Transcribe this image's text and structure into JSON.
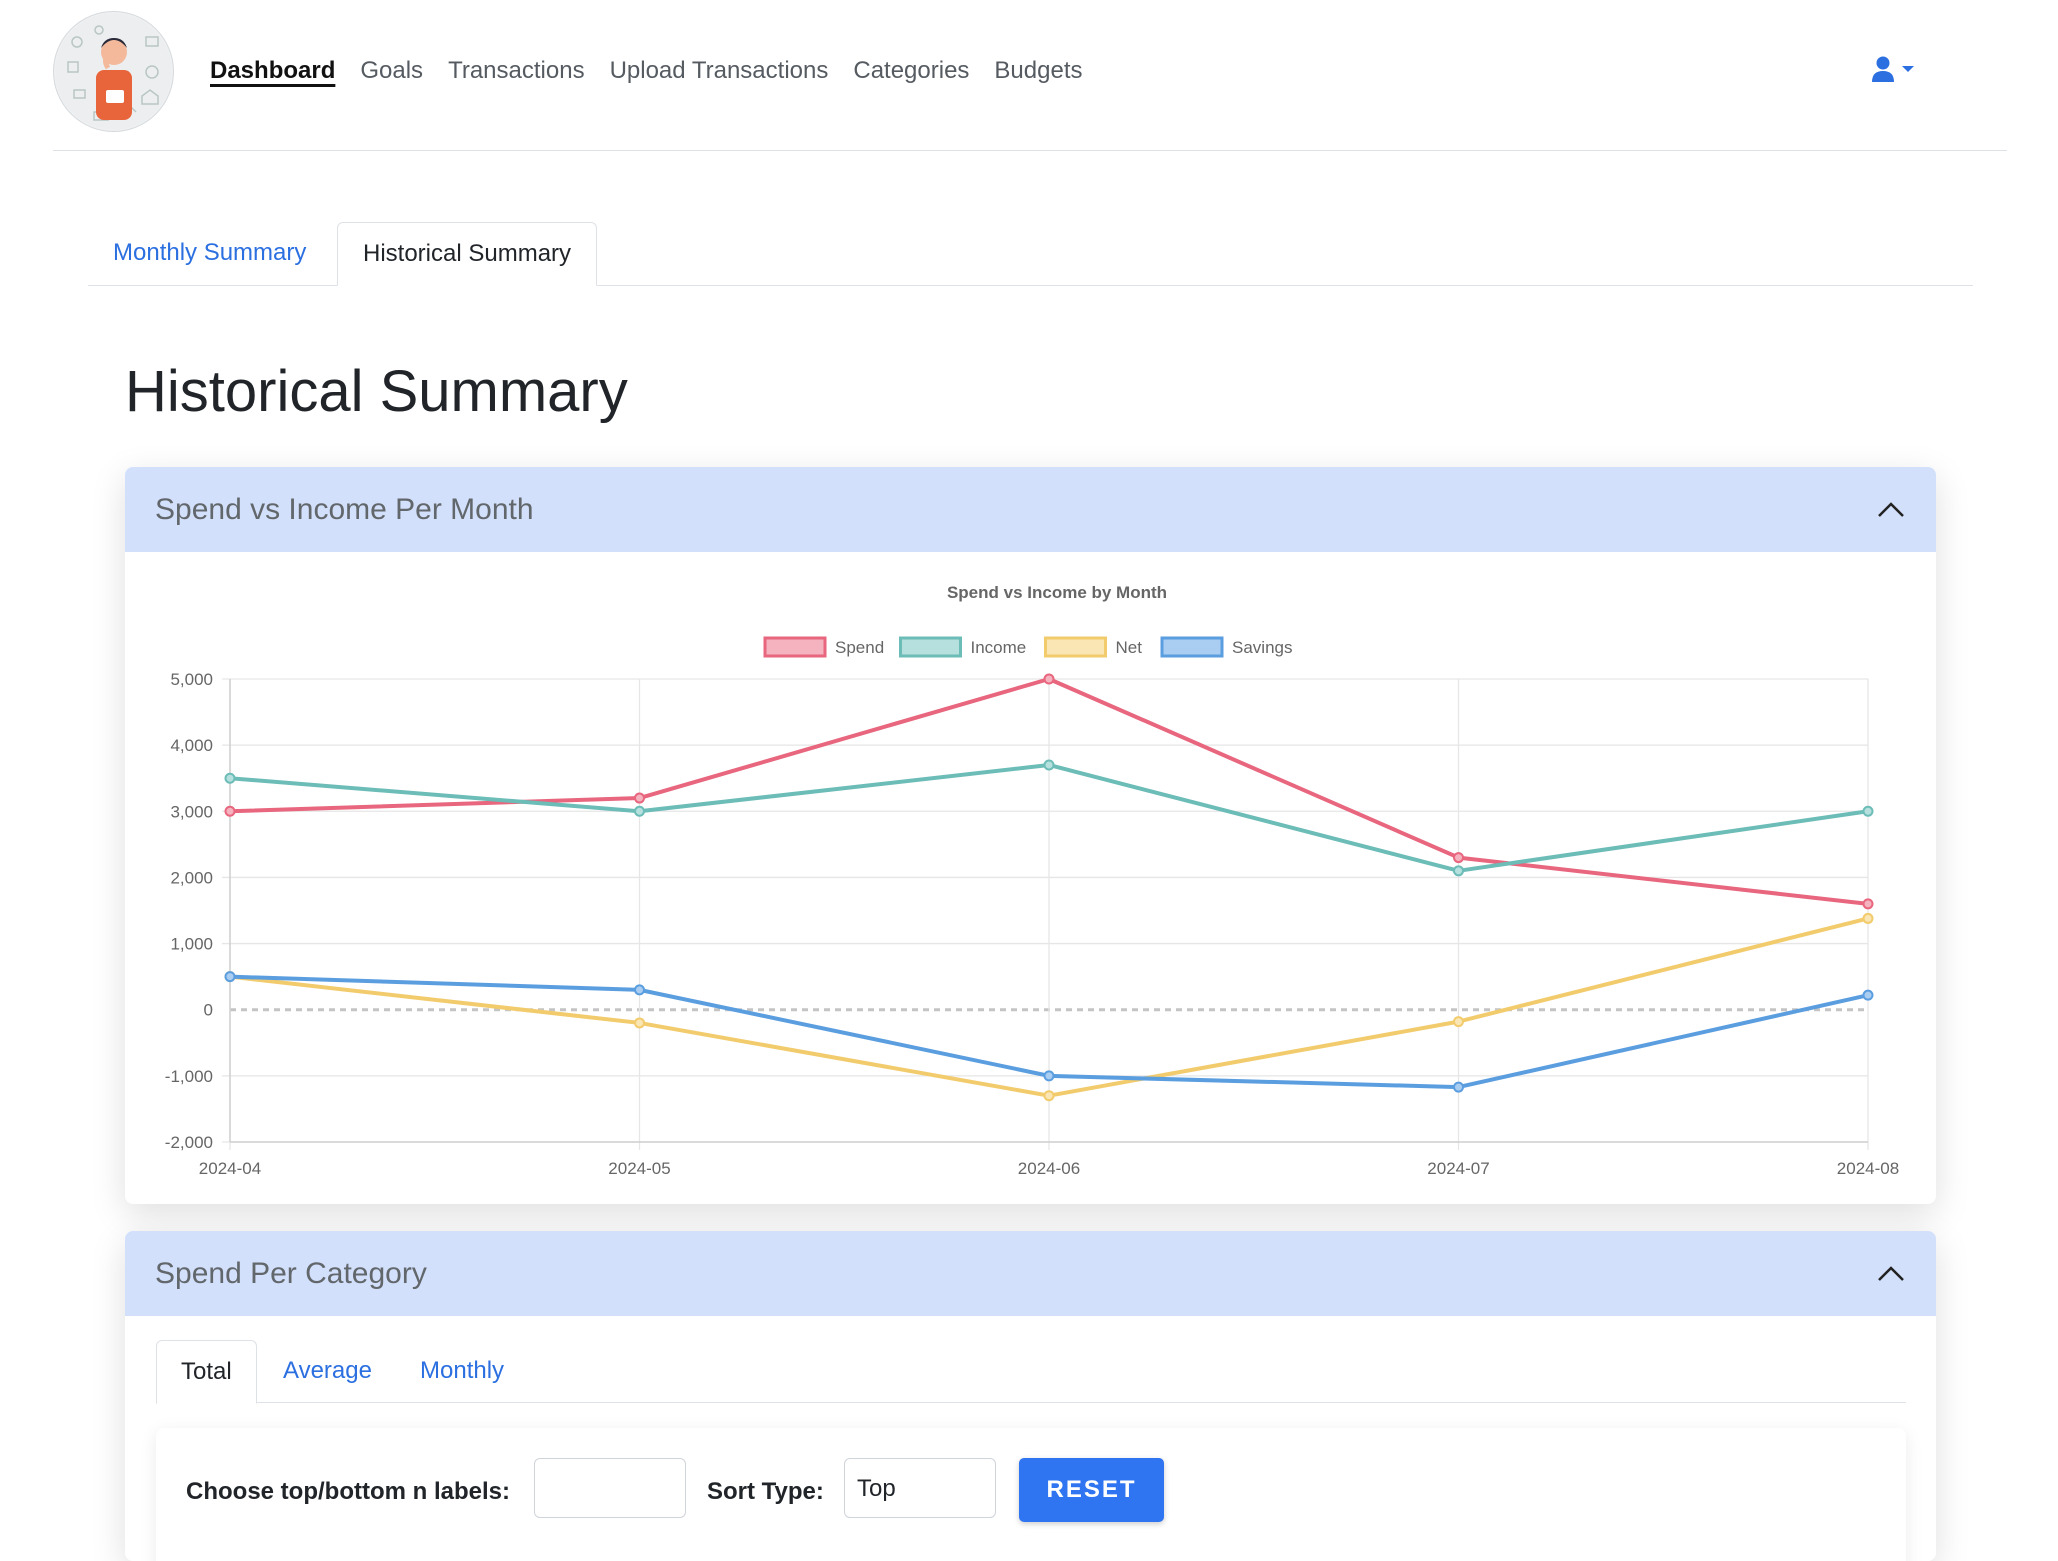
{
  "nav": {
    "items": [
      {
        "label": "Dashboard",
        "active": true
      },
      {
        "label": "Goals",
        "active": false
      },
      {
        "label": "Transactions",
        "active": false
      },
      {
        "label": "Upload Transactions",
        "active": false
      },
      {
        "label": "Categories",
        "active": false
      },
      {
        "label": "Budgets",
        "active": false
      }
    ],
    "user_icon": "user-icon",
    "accent": "#2b6fe0"
  },
  "tabs": [
    {
      "label": "Monthly Summary",
      "active": false
    },
    {
      "label": "Historical Summary",
      "active": true
    }
  ],
  "page_title": "Historical Summary",
  "spend_income_card": {
    "title": "Spend vs Income Per Month",
    "collapse_icon": "chevron-up-icon"
  },
  "chart_data": {
    "type": "line",
    "title": "Spend vs Income by Month",
    "categories": [
      "2024-04",
      "2024-05",
      "2024-06",
      "2024-07",
      "2024-08"
    ],
    "series": [
      {
        "name": "Spend",
        "values": [
          3000,
          3200,
          5000,
          2300,
          1600
        ],
        "color": "#e8667e",
        "fill": "#f5b3c0"
      },
      {
        "name": "Income",
        "values": [
          3500,
          3000,
          3700,
          2100,
          3000
        ],
        "color": "#6cbcb7",
        "fill": "#b6e0de"
      },
      {
        "name": "Net",
        "values": [
          500,
          -200,
          -1300,
          -180,
          1380
        ],
        "color": "#f2cb6c",
        "fill": "#fae6b4"
      },
      {
        "name": "Savings",
        "values": [
          500,
          300,
          -1000,
          -1170,
          220
        ],
        "color": "#5b9ee0",
        "fill": "#aacdf2"
      }
    ],
    "ylim": [
      -2000,
      5000
    ],
    "yticks": [
      "5,000",
      "4,000",
      "3,000",
      "2,000",
      "1,000",
      "0",
      "-1,000",
      "-2,000"
    ],
    "ytick_values": [
      5000,
      4000,
      3000,
      2000,
      1000,
      0,
      -1000,
      -2000
    ],
    "grid": true,
    "zero_line": "dashed",
    "legend": "top"
  },
  "category_card": {
    "title": "Spend Per Category",
    "collapse_icon": "chevron-up-icon",
    "tabs": [
      {
        "label": "Total",
        "active": true
      },
      {
        "label": "Average",
        "active": false
      },
      {
        "label": "Monthly",
        "active": false
      }
    ],
    "filter": {
      "n_label": "Choose top/bottom n labels:",
      "n_value": "",
      "sort_label": "Sort Type:",
      "sort_value": "Top",
      "reset_label": "RESET"
    }
  }
}
